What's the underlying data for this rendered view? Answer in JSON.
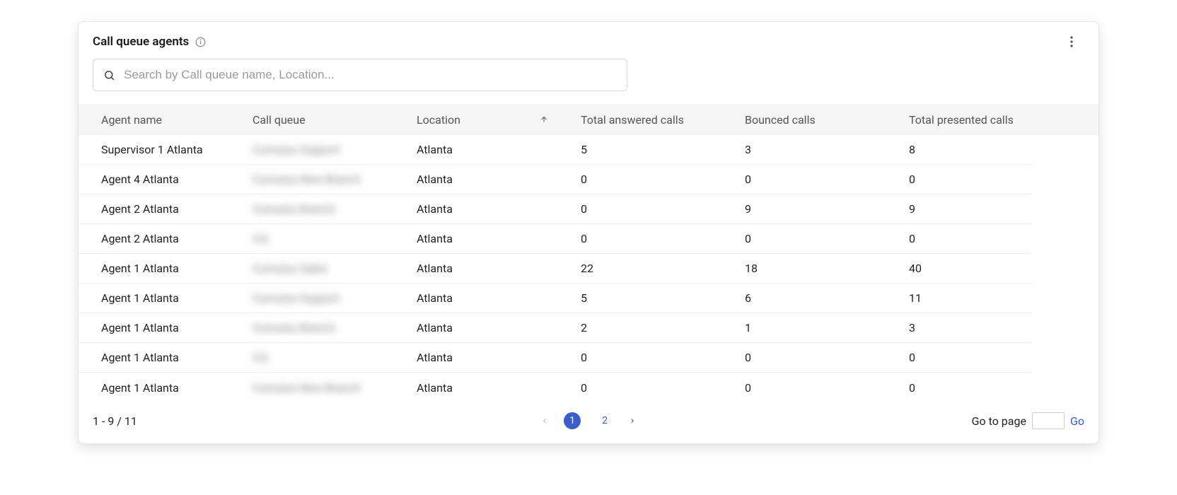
{
  "header": {
    "title": "Call queue agents"
  },
  "search": {
    "placeholder": "Search by Call queue name, Location...",
    "value": ""
  },
  "columns": {
    "agent_name": "Agent name",
    "call_queue": "Call queue",
    "location": "Location",
    "total_answered": "Total answered calls",
    "bounced": "Bounced calls",
    "total_presented": "Total presented calls"
  },
  "rows": [
    {
      "agent_name": "Supervisor 1 Atlanta",
      "call_queue": "Cumulus Support",
      "location": "Atlanta",
      "total_answered": "5",
      "bounced": "3",
      "total_presented": "8"
    },
    {
      "agent_name": "Agent 4 Atlanta",
      "call_queue": "Cumulus New Branch",
      "location": "Atlanta",
      "total_answered": "0",
      "bounced": "0",
      "total_presented": "0"
    },
    {
      "agent_name": "Agent 2 Atlanta",
      "call_queue": "Cumulus Branch",
      "location": "Atlanta",
      "total_answered": "0",
      "bounced": "9",
      "total_presented": "9"
    },
    {
      "agent_name": "Agent 2 Atlanta",
      "call_queue": "CQ",
      "location": "Atlanta",
      "total_answered": "0",
      "bounced": "0",
      "total_presented": "0"
    },
    {
      "agent_name": "Agent 1 Atlanta",
      "call_queue": "Cumulus Sales",
      "location": "Atlanta",
      "total_answered": "22",
      "bounced": "18",
      "total_presented": "40"
    },
    {
      "agent_name": "Agent 1 Atlanta",
      "call_queue": "Cumulus Support",
      "location": "Atlanta",
      "total_answered": "5",
      "bounced": "6",
      "total_presented": "11"
    },
    {
      "agent_name": "Agent 1 Atlanta",
      "call_queue": "Cumulus Branch",
      "location": "Atlanta",
      "total_answered": "2",
      "bounced": "1",
      "total_presented": "3"
    },
    {
      "agent_name": "Agent 1 Atlanta",
      "call_queue": "CQ",
      "location": "Atlanta",
      "total_answered": "0",
      "bounced": "0",
      "total_presented": "0"
    },
    {
      "agent_name": "Agent 1 Atlanta",
      "call_queue": "Cumulus New Branch",
      "location": "Atlanta",
      "total_answered": "0",
      "bounced": "0",
      "total_presented": "0"
    }
  ],
  "pagination": {
    "range_text": "1 - 9 / 11",
    "pages": [
      "1",
      "2"
    ],
    "active": "1",
    "goto_label": "Go to page",
    "go_label": "Go"
  }
}
